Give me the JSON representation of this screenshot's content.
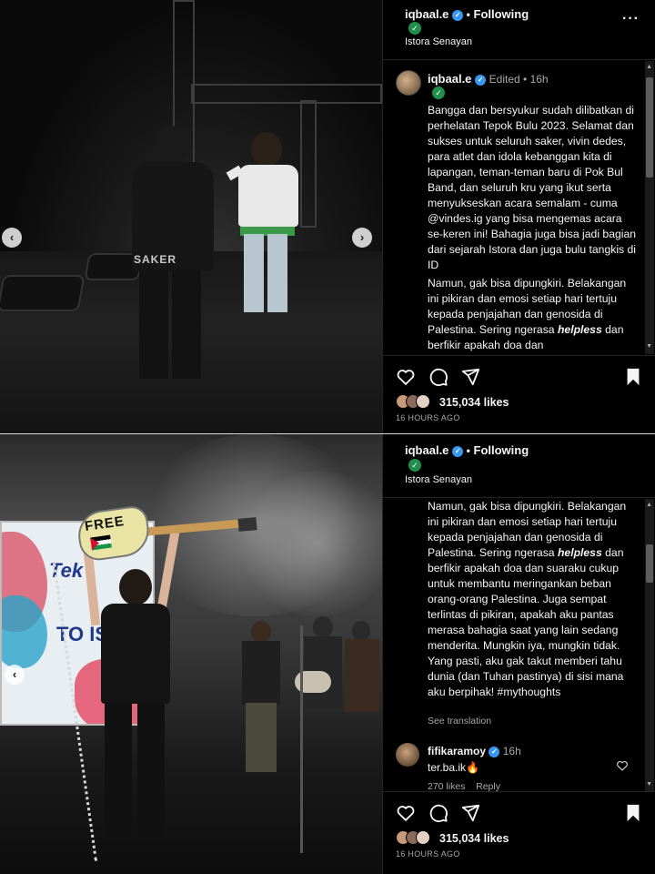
{
  "post": {
    "username": "iqbaal.e",
    "following_label": "Following",
    "location": "Istora Senayan",
    "edited_label": "Edited",
    "time_ago": "16h",
    "caption_part1": "Bangga dan bersyukur sudah dilibatkan di perhelatan Tepok Bulu 2023. Selamat dan sukses untuk seluruh saker, vivin dedes, para atlet dan idola kebanggan kita di lapangan, teman-teman baru di Pok Bul Band, dan seluruh kru yang ikut serta menyukseskan acara semalam - cuma @vindes.ig yang bisa mengemas acara se-keren ini! Bahagia juga bisa jadi bagian dari sejarah Istora dan juga bulu tangkis di ID",
    "caption_part2_a": "Namun, gak bisa dipungkiri. Belakangan ini pikiran dan emosi setiap hari tertuju kepada penjajahan dan genosida di Palestina. Sering ngerasa ",
    "caption_helpless": "helpless",
    "caption_part2_b": " dan berfikir apakah doa dan suaraku cukup untuk membantu meringankan beban orang-orang Palestina. Juga sempat terlintas di pikiran, apakah aku pantas merasa bahagia saat yang lain sedang menderita. Mungkin iya, mungkin tidak. Yang pasti, aku gak takut memberi tahu dunia (dan Tuhan pastinya) di sisi mana aku berpihak! #mythoughts",
    "panel1_tail": "dan berfikir apakah doa dan",
    "see_translation": "See translation",
    "likes": "315,034 likes",
    "time_label": "16 HOURS AGO"
  },
  "photo_text": {
    "shirt_text": "SAKER",
    "guitar_text": "FREE",
    "screen_text_1": "Tek",
    "screen_text_2": "TO IS"
  },
  "comment": {
    "username": "fifikaramoy",
    "time_ago": "16h",
    "text": "ter.ba.ik🔥",
    "likes": "270 likes",
    "reply": "Reply"
  },
  "icons": {
    "more": "more-icon",
    "heart": "heart-icon",
    "comment": "comment-icon",
    "share": "share-icon",
    "bookmark": "bookmark-icon"
  },
  "colors": {
    "verified": "#3897f0",
    "badge": "#1f8f4a",
    "background": "#000000",
    "muted": "#a8a8a8"
  }
}
